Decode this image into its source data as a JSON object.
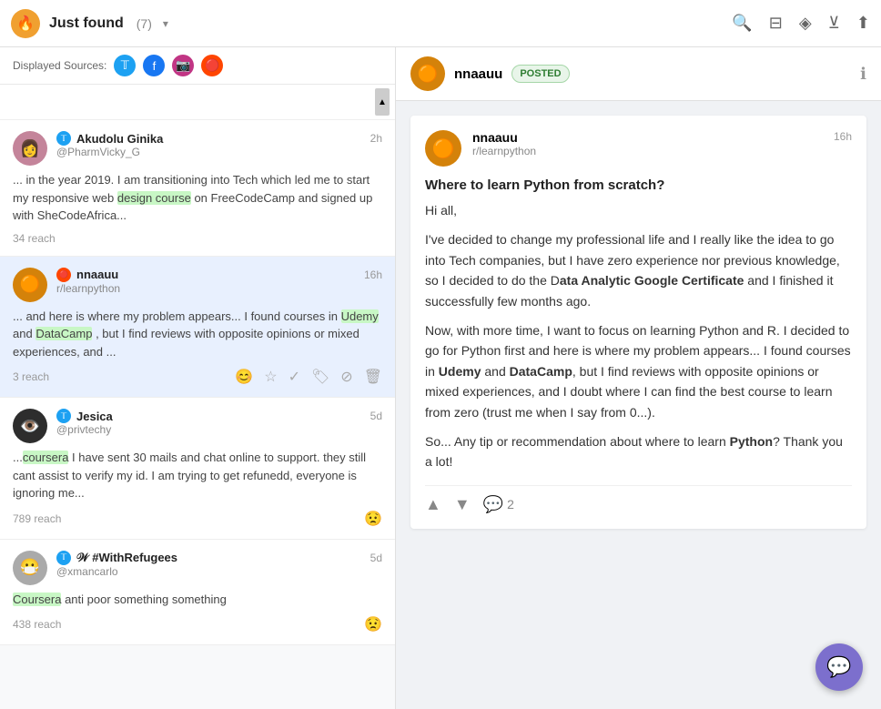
{
  "header": {
    "title": "Just found",
    "count": "(7)",
    "chevron": "▾",
    "icons": [
      "search",
      "sort",
      "layers",
      "filter",
      "share"
    ]
  },
  "sources": {
    "label": "Displayed Sources:",
    "items": [
      {
        "name": "Twitter",
        "symbol": "𝕋",
        "type": "twitter"
      },
      {
        "name": "Facebook",
        "symbol": "f",
        "type": "facebook"
      },
      {
        "name": "Instagram",
        "symbol": "📷",
        "type": "instagram"
      },
      {
        "name": "Reddit",
        "symbol": "r",
        "type": "reddit"
      }
    ]
  },
  "feed": [
    {
      "id": 1,
      "name": "Akudolu Ginika",
      "handle": "@PharmVicky_G",
      "source": "twitter",
      "time": "2h",
      "avatar_emoji": "👩",
      "avatar_bg": "#e8a0b0",
      "text": "... in the year 2019. I am transitioning into Tech which led me to start my responsive web design course on FreeCodeCamp and signed up with SheCodeAfrica...",
      "highlight": "design course",
      "reach": "34 reach",
      "active": false
    },
    {
      "id": 2,
      "name": "nnaauu",
      "handle": "r/learnpython",
      "source": "reddit",
      "time": "16h",
      "avatar_emoji": "🟠",
      "avatar_bg": "#d4820a",
      "text": "... and here is where my problem appears... I found courses in Udemy and DataCamp , but I find reviews with opposite opinions or mixed experiences, and ...",
      "highlight_words": [
        "Udemy",
        "DataCamp"
      ],
      "reach": "3 reach",
      "active": true
    },
    {
      "id": 3,
      "name": "Jesica",
      "handle": "@privtechy",
      "source": "twitter",
      "time": "5d",
      "avatar_emoji": "👁️",
      "avatar_bg": "#2d2d2d",
      "text": "...coursera I have sent 30 mails and chat online to support. they still cant assist to verify my id. I am trying to get refunedd, everyone is ignoring me...",
      "highlight_words": [
        "coursera"
      ],
      "reach": "789 reach",
      "active": false
    },
    {
      "id": 4,
      "name": "𝒲 #WithRefugees",
      "handle": "@xmancarlo",
      "source": "twitter",
      "time": "5d",
      "avatar_emoji": "😷",
      "avatar_bg": "#888",
      "text": "Coursera anti poor something something",
      "highlight_words": [
        "Coursera"
      ],
      "reach": "438 reach",
      "active": false
    }
  ],
  "detail": {
    "username": "nnaauu",
    "posted_label": "POSTED",
    "subreddit": "r/learnpython",
    "time": "16h",
    "title": "Where to learn Python from scratch?",
    "body_parts": [
      {
        "text": "Hi all,",
        "type": "plain"
      },
      {
        "text": "I've decided to change my professional life and I really like the idea to go into Tech companies, but I have zero experience nor previous knowledge, so I decided to do the D",
        "type": "plain"
      },
      {
        "text": "ata Analytic Google Certificate",
        "type": "bold"
      },
      {
        "text": " and I finished it successfully few months ago.",
        "type": "plain"
      },
      {
        "text": "Now, with more time, I want to focus on learning Python and R. I decided to go for Python first and here is where my problem appears... I found courses in ",
        "type": "plain"
      },
      {
        "text": "Udemy",
        "type": "bold"
      },
      {
        "text": " and ",
        "type": "plain"
      },
      {
        "text": "DataCamp",
        "type": "bold"
      },
      {
        "text": ", but I find reviews with opposite opinions or mixed experiences, and I doubt where I can find the best course to learn from zero (trust me when I say from 0...).",
        "type": "plain"
      },
      {
        "text": "So... Any tip or recommendation about where to learn ",
        "type": "plain"
      },
      {
        "text": "Python",
        "type": "bold"
      },
      {
        "text": "? Thank you a lot!",
        "type": "plain"
      }
    ],
    "upvote_label": "▲",
    "downvote_label": "▼",
    "comments": "2"
  },
  "chat_fab": "💬"
}
